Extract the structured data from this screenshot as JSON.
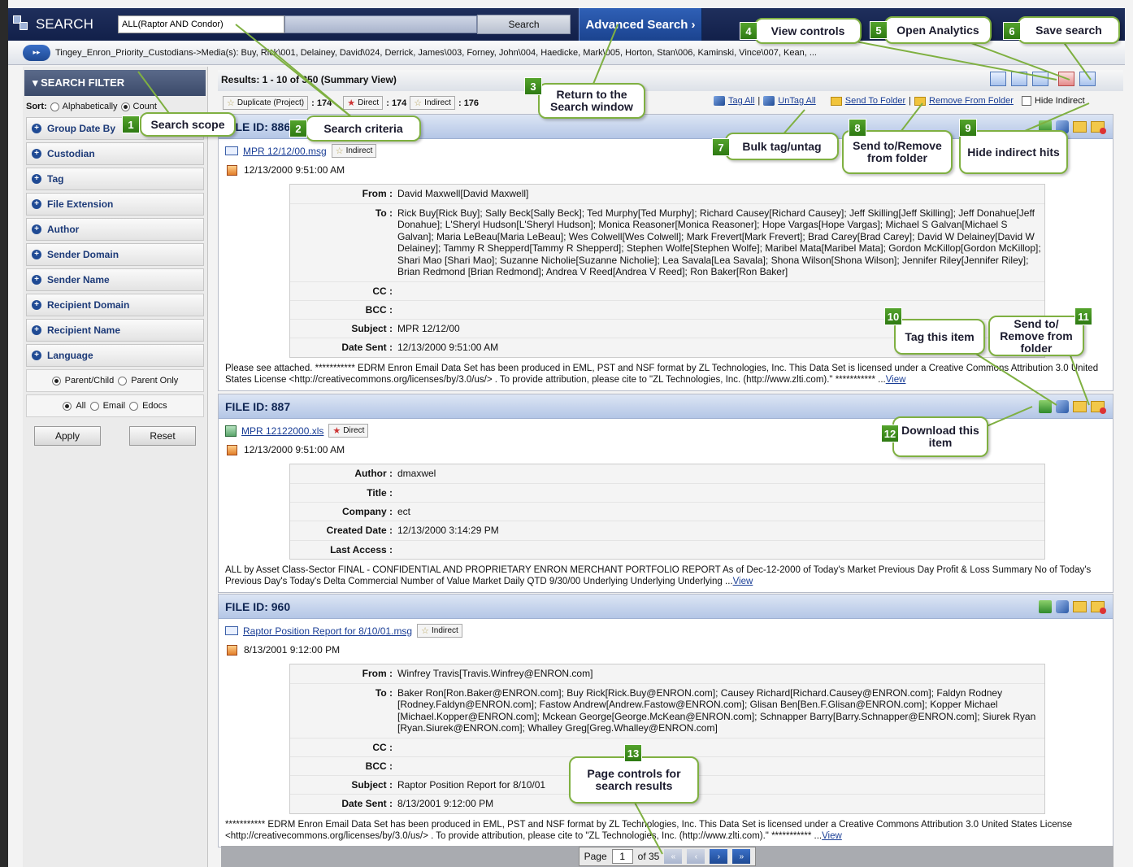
{
  "top": {
    "logo_text": "SEARCH",
    "search_value": "ALL(Raptor AND Condor)",
    "search_button": "Search",
    "advanced_button": "Advanced Search ›"
  },
  "breadcrumb": {
    "arrow": "▸▸",
    "text": "Tingey_Enron_Priority_Custodians->Media(s): Buy, Rick\\001, Delainey, David\\024, Derrick, James\\003, Forney, John\\004, Haedicke, Mark\\005, Horton, Stan\\006, Kaminski, Vince\\007, Kean, ..."
  },
  "filter": {
    "title": "▾ SEARCH FILTER",
    "sort_label": "Sort:",
    "sort_alpha": "Alphabetically",
    "sort_count": "Count",
    "items": [
      "Group Date By",
      "Custodian",
      "Tag",
      "File Extension",
      "Author",
      "Sender Domain",
      "Sender Name",
      "Recipient Domain",
      "Recipient Name",
      "Language"
    ],
    "opt_parent_child": "Parent/Child",
    "opt_parent_only": "Parent Only",
    "opt_all": "All",
    "opt_email": "Email",
    "opt_edocs": "Edocs",
    "apply": "Apply",
    "reset": "Reset"
  },
  "results": {
    "header": "Results: 1 - 10 of 350 (Summary View)",
    "dup_label": "Duplicate (Project)",
    "dup_count": ": 174",
    "direct_label": "Direct",
    "direct_count": ": 174",
    "indirect_label": "Indirect",
    "indirect_count": ": 176",
    "tag_all": "Tag All",
    "untag_all": "UnTag All",
    "send_to_folder": "Send To Folder",
    "remove_from_folder": "Remove From Folder",
    "hide_indirect": "Hide Indirect"
  },
  "cards": [
    {
      "file_id": "FILE ID: 886",
      "file_name": "MPR 12/12/00.msg",
      "hit_type": "Indirect",
      "date": "12/13/2000 9:51:00 AM",
      "rows": [
        {
          "k": "From :",
          "v": "David Maxwell[David Maxwell]"
        },
        {
          "k": "To :",
          "v": "Rick Buy[Rick Buy]; Sally Beck[Sally Beck]; Ted Murphy[Ted Murphy]; Richard Causey[Richard Causey]; Jeff Skilling[Jeff Skilling]; Jeff Donahue[Jeff Donahue]; L'Sheryl Hudson[L'Sheryl Hudson]; Monica Reasoner[Monica Reasoner]; Hope Vargas[Hope Vargas]; Michael S Galvan[Michael S Galvan]; Maria LeBeau[Maria LeBeau]; Wes Colwell[Wes Colwell]; Mark Frevert[Mark Frevert]; Brad Carey[Brad Carey]; David W Delainey[David W Delainey]; Tammy R Shepperd[Tammy R Shepperd]; Stephen Wolfe[Stephen Wolfe]; Maribel Mata[Maribel Mata]; Gordon McKillop[Gordon McKillop]; Shari Mao [Shari Mao]; Suzanne Nicholie[Suzanne Nicholie]; Lea Savala[Lea Savala]; Shona Wilson[Shona Wilson]; Jennifer Riley[Jennifer Riley]; Brian Redmond [Brian Redmond]; Andrea V Reed[Andrea V Reed]; Ron Baker[Ron Baker]"
        },
        {
          "k": "CC :",
          "v": ""
        },
        {
          "k": "BCC :",
          "v": ""
        },
        {
          "k": "Subject :",
          "v": "MPR 12/12/00"
        },
        {
          "k": "Date Sent :",
          "v": "12/13/2000 9:51:00 AM"
        }
      ],
      "snippet": "Please see attached. *********** EDRM Enron Email Data Set has been produced in EML, PST and NSF format by ZL Technologies, Inc. This Data Set is licensed under a Creative Commons Attribution 3.0 United States License <http://creativecommons.org/licenses/by/3.0/us/> . To provide attribution, please cite to \"ZL Technologies, Inc. (http://www.zlti.com).\" *********** ...",
      "view": "View"
    },
    {
      "file_id": "FILE ID: 887",
      "file_name": "MPR 12122000.xls",
      "hit_type": "Direct",
      "date": "12/13/2000 9:51:00 AM",
      "rows": [
        {
          "k": "Author :",
          "v": "dmaxwel"
        },
        {
          "k": "Title :",
          "v": ""
        },
        {
          "k": "Company :",
          "v": "ect"
        },
        {
          "k": "Created Date :",
          "v": "12/13/2000 3:14:29 PM"
        },
        {
          "k": "Last Access :",
          "v": ""
        }
      ],
      "snippet": "ALL by Asset Class-Sector FINAL - CONFIDENTIAL AND PROPRIETARY ENRON MERCHANT PORTFOLIO REPORT As of Dec-12-2000 of Today's Market Previous Day Profit & Loss Summary No of Today's Previous Day's Today's Delta Commercial Number of Value Market Daily QTD 9/30/00 Underlying Underlying Underlying ...",
      "view": "View"
    },
    {
      "file_id": "FILE ID: 960",
      "file_name": "Raptor Position Report for 8/10/01.msg",
      "hit_type": "Indirect",
      "date": "8/13/2001 9:12:00 PM",
      "rows": [
        {
          "k": "From :",
          "v": "Winfrey Travis[Travis.Winfrey@ENRON.com]"
        },
        {
          "k": "To :",
          "v": "Baker Ron[Ron.Baker@ENRON.com]; Buy Rick[Rick.Buy@ENRON.com]; Causey Richard[Richard.Causey@ENRON.com]; Faldyn Rodney [Rodney.Faldyn@ENRON.com]; Fastow Andrew[Andrew.Fastow@ENRON.com]; Glisan Ben[Ben.F.Glisan@ENRON.com]; Kopper Michael [Michael.Kopper@ENRON.com]; Mckean George[George.McKean@ENRON.com]; Schnapper Barry[Barry.Schnapper@ENRON.com]; Siurek Ryan [Ryan.Siurek@ENRON.com]; Whalley Greg[Greg.Whalley@ENRON.com]"
        },
        {
          "k": "CC :",
          "v": ""
        },
        {
          "k": "BCC :",
          "v": ""
        },
        {
          "k": "Subject :",
          "v": "Raptor Position Report for 8/10/01"
        },
        {
          "k": "Date Sent :",
          "v": "8/13/2001 9:12:00 PM"
        }
      ],
      "snippet": "*********** EDRM Enron Email Data Set has been produced in EML, PST and NSF format by ZL Technologies, Inc. This Data Set is licensed under a Creative Commons Attribution 3.0 United States License <http://creativecommons.org/licenses/by/3.0/us/> . To provide attribution, please cite to \"ZL Technologies, Inc. (http://www.zlti.com).\" *********** ...",
      "view": "View"
    }
  ],
  "pager": {
    "page_label": "Page",
    "page_value": "1",
    "of_label": "of 35"
  },
  "callouts": [
    {
      "n": "1",
      "text": "Search scope"
    },
    {
      "n": "2",
      "text": "Search criteria"
    },
    {
      "n": "3",
      "text": "Return to the Search window"
    },
    {
      "n": "4",
      "text": "View controls"
    },
    {
      "n": "5",
      "text": "Open Analytics"
    },
    {
      "n": "6",
      "text": "Save search"
    },
    {
      "n": "7",
      "text": "Bulk tag/untag"
    },
    {
      "n": "8",
      "text": "Send to/Remove from folder"
    },
    {
      "n": "9",
      "text": "Hide indirect hits"
    },
    {
      "n": "10",
      "text": "Tag this item"
    },
    {
      "n": "11",
      "text": "Send to/ Remove from folder"
    },
    {
      "n": "12",
      "text": "Download this item"
    },
    {
      "n": "13",
      "text": "Page controls for search results"
    }
  ],
  "colors": {
    "header_navy": "#1f2f5c",
    "accent_blue": "#1f4a94",
    "callout_green": "#7fb041"
  }
}
